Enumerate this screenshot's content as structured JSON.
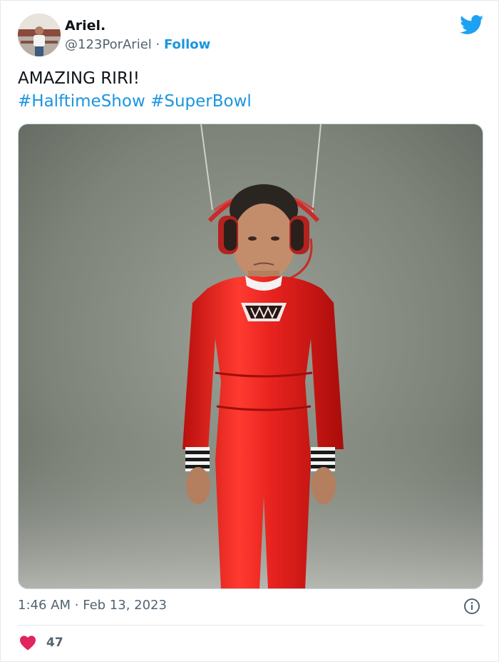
{
  "tweet": {
    "author": {
      "display_name": "Ariel.",
      "handle": "@123PorAriel",
      "separator": "·",
      "follow_label": "Follow"
    },
    "text_line": "AMAZING RIRI!",
    "hashtags": [
      "#HalftimeShow",
      "#SuperBowl"
    ],
    "time": "1:46 AM",
    "date_separator": "·",
    "date": "Feb 13, 2023",
    "likes_count": "47"
  },
  "colors": {
    "link_blue": "#1b95e0",
    "heart_red": "#e0245e",
    "muted_text": "#536471",
    "twitter_bird": "#1da1f2",
    "suit_red": "#e8231f"
  },
  "icons": {
    "brand": "twitter-bird-icon",
    "info": "info-icon",
    "like": "heart-icon"
  }
}
